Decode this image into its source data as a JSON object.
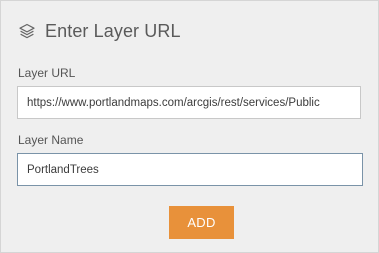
{
  "dialog": {
    "title": "Enter Layer URL",
    "title_icon": "layers-icon"
  },
  "layer_url": {
    "label": "Layer URL",
    "value": "https://www.portlandmaps.com/arcgis/rest/services/Public"
  },
  "layer_name": {
    "label": "Layer Name",
    "value": "PortlandTrees"
  },
  "add_button": {
    "label": "ADD",
    "color": "#e8913a"
  }
}
